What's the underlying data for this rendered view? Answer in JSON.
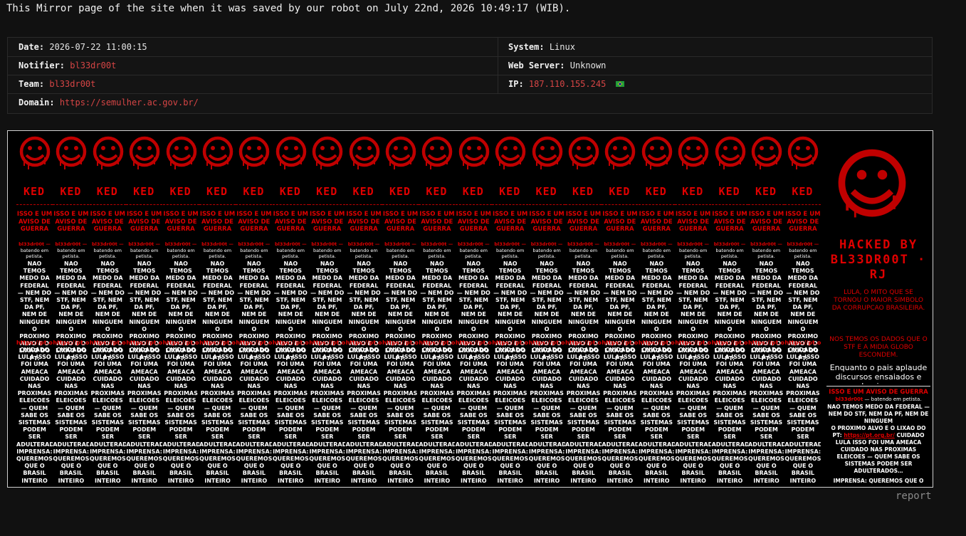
{
  "banner": "This Mirror page of the site when it was saved by our robot on July 22nd, 2026 10:49:17 (WIB).",
  "info": {
    "date_label": "Date:",
    "date_value": "2026-07-22 11:00:15",
    "notifier_label": "Notifier:",
    "notifier_value": "bl33dr00t",
    "team_label": "Team:",
    "team_value": "bl33dr00t",
    "domain_label": "Domain:",
    "domain_value": "https://semulher.ac.gov.br/",
    "system_label": "System:",
    "system_value": "Linux",
    "server_label": "Web Server:",
    "server_value": "Unknown",
    "ip_label": "IP:",
    "ip_value": "187.110.155.245",
    "ip_flag": "brazil-flag-icon",
    "colors": {
      "accent": "#d64545",
      "background": "#111111"
    }
  },
  "mirror": {
    "columns": 22,
    "column": {
      "hacked_fragment": "KED",
      "title": "ISSO E UM AVISO DE GUERRA",
      "author": "bl33dr00t —",
      "author_note": "batendo em petista.",
      "message": "NAO TEMOS MEDO DA FEDERAL — NEM DO STF, NEM DA PF, NEM DE NINGUEM O PROXIMO ALVO E O LIXAO DO PT:",
      "link": "https://pt.org.br/",
      "message2": "CUIDADO LULA ISSO FOI UMA AMEACA CUIDADO NAS PROXIMAS ELEICOES — QUEM SABE OS SISTEMAS PODEM SER ADULTERADOS… IMPRENSA: QUEREMOS QUE O BRASIL INTEIRO VEJA"
    },
    "side": {
      "hacked": "HACKED BY BL33DR00T · RJ",
      "lula": "LULA, O MITO QUE SE TORNOU O MAIOR SIMBOLO DA CORRUPCAO BRASILEIRA.",
      "nos": "NOS TEMOS OS DADOS QUE O STF E A MIDIA GLOBO ESCONDEM.",
      "enquanto": "Enquanto o pais aplaude discursos ensaiados e lagrimas",
      "title": "ISSO E UM AVISO DE GUERRA",
      "author": "bl33dr00t",
      "author_note": "— batendo em petista.",
      "body1": "NAO TEMOS MEDO DA FEDERAL — NEM DO STF, NEM DA PF, NEM DE NINGUEM",
      "body2": "O PROXIMO ALVO E O LIXAO DO PT:",
      "link": "https://pt.org.br/",
      "body3": " CUIDADO LULA ISSO FOI UMA AMEACA CUIDADO NAS PROXIMAS ELEICOES — QUEM SABE OS SISTEMAS PODEM SER ADULTERADOS…",
      "body4": "IMPRENSA: QUEREMOS QUE O BRASIL INTEIRO VEJA"
    },
    "colors": {
      "accent": "#e00000",
      "background": "#000000"
    }
  },
  "report": "report"
}
